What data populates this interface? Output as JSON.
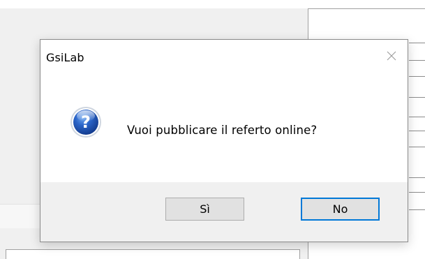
{
  "dialog": {
    "title": "GsiLab",
    "close_icon": "close-icon",
    "icon": "question-icon",
    "message": "Vuoi pubblicare il referto online?",
    "buttons": {
      "yes_label": "Sì",
      "no_label": "No",
      "default": "No"
    }
  },
  "colors": {
    "accent": "#0078d7",
    "button_face": "#e1e1e1",
    "footer_bg": "#f0f0f0"
  }
}
